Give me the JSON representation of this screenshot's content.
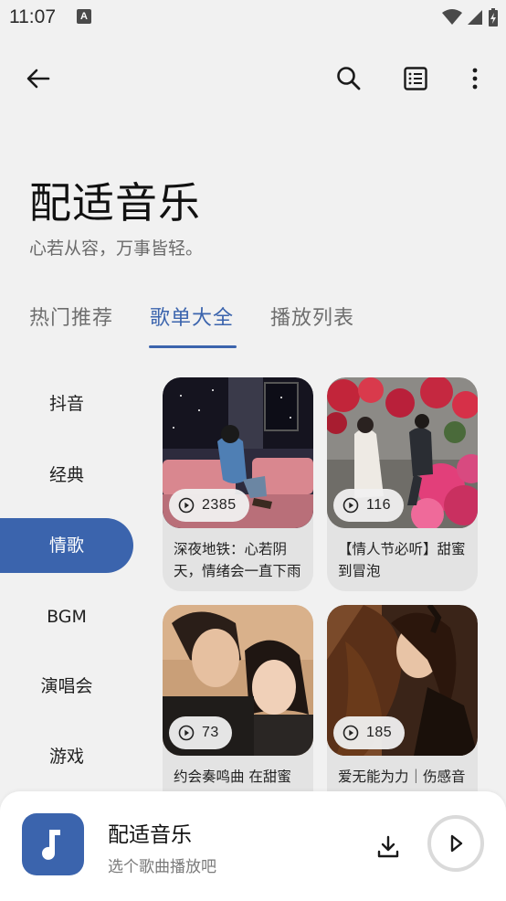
{
  "status_bar": {
    "time": "11:07",
    "notification_glyph": "A"
  },
  "header": {
    "title": "配适音乐",
    "subtitle": "心若从容，万事皆轻。"
  },
  "tabs": [
    {
      "label": "热门推荐"
    },
    {
      "label": "歌单大全",
      "active": true
    },
    {
      "label": "播放列表"
    }
  ],
  "sidebar": {
    "items": [
      {
        "label": "抖音"
      },
      {
        "label": "经典"
      },
      {
        "label": "情歌",
        "active": true
      },
      {
        "label": "BGM"
      },
      {
        "label": "演唱会"
      },
      {
        "label": "游戏"
      }
    ]
  },
  "playlists": [
    {
      "plays": "2385",
      "title": "深夜地铁：心若阴天，情绪会一直下雨"
    },
    {
      "plays": "116",
      "title": "【情人节必听】甜蜜到冒泡"
    },
    {
      "plays": "73",
      "title": "约会奏鸣曲 在甜蜜"
    },
    {
      "plays": "185",
      "title": "爱无能为力｜伤感音"
    }
  ],
  "player": {
    "title": "配适音乐",
    "subtitle": "选个歌曲播放吧"
  },
  "colors": {
    "accent": "#3b64ad",
    "background": "#f1f1f1",
    "card": "#e3e3e3"
  },
  "icons": [
    "back-arrow-icon",
    "search-icon",
    "list-icon",
    "more-vert-icon",
    "play-circle-icon",
    "music-note-icon",
    "download-icon",
    "play-icon"
  ]
}
